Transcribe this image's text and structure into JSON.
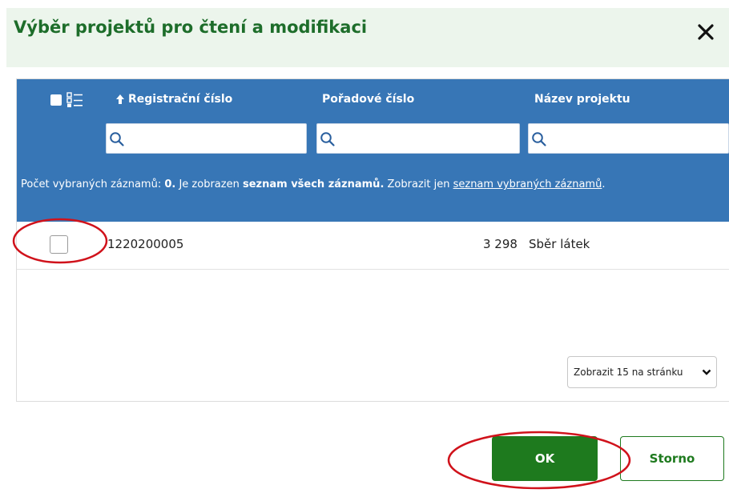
{
  "dialog": {
    "title": "Výběr projektů pro čtení a modifikaci",
    "close_icon": "close-icon"
  },
  "table": {
    "columns": [
      {
        "label": "Registrační číslo",
        "sort": "ascending"
      },
      {
        "label": "Pořadové číslo"
      },
      {
        "label": "Název projektu"
      }
    ],
    "search_placeholders": [
      "",
      "",
      ""
    ],
    "info": {
      "part1": "Počet vybraných záznamů: ",
      "count": "0.",
      "part2": " Je zobrazen ",
      "bold": "seznam všech záznamů.",
      "part3": " Zobrazit jen ",
      "link": "seznam vybraných záznamů",
      "end": "."
    },
    "rows": [
      {
        "registracni": "1220200005",
        "poradove": "3 298",
        "nazev": "Sběr látek",
        "checked": false
      }
    ],
    "page_size_label": "Zobrazit 15 na stránku"
  },
  "buttons": {
    "ok": "OK",
    "cancel": "Storno"
  },
  "colors": {
    "header_bg": "#3776b6",
    "title": "#1d6d2a",
    "primary": "#1e7a1e",
    "annotation": "#d0121b"
  }
}
